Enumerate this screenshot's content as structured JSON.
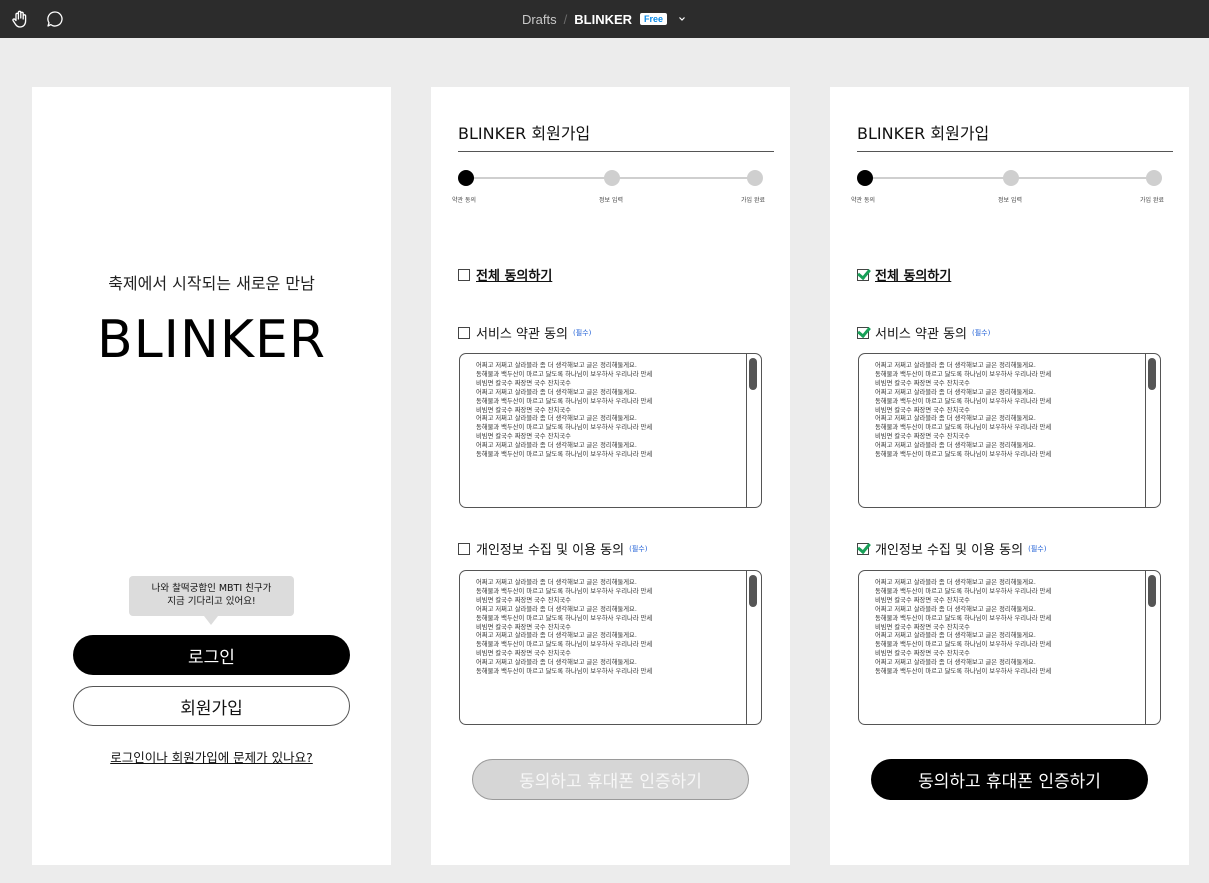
{
  "toolbar": {
    "breadcrumb_parent": "Drafts",
    "breadcrumb_separator": "/",
    "file_name": "BLINKER",
    "plan_badge": "Free",
    "icons": [
      "hand-tool-icon",
      "comment-icon",
      "chevron-down-icon"
    ]
  },
  "login": {
    "tagline": "축제에서 시작되는 새로운 만남",
    "logo": "BLINKER",
    "tooltip_line1": "나와 찰떡궁합인 MBTI 친구가",
    "tooltip_line2": "지금 기다리고 있어요!",
    "login_button": "로그인",
    "signup_button": "회원가입",
    "help_link": "로그인이나 회원가입에 문제가 있나요?"
  },
  "signup_unchecked": {
    "title": "BLINKER 회원가입",
    "steps": [
      "약관 동의",
      "정보 입력",
      "가입 완료"
    ],
    "current_step": 1,
    "agree_all": {
      "label": "전체 동의하기",
      "checked": false
    },
    "service_terms": {
      "label": "서비스 약관 동의",
      "required": "(필수)",
      "checked": false
    },
    "privacy_terms": {
      "label": "개인정보 수집 및 이용 동의",
      "required": "(필수)",
      "checked": false
    },
    "terms_text": "어쩌고 저쩌고 살라블라 좀 더 생각해보고 글은 정리해둘게요.\n동해물과 백두산이 마르고 닳도록 하나님이 보우하사 우리나라 만세\n비빔면 칼국수 짜장면 국수 잔치국수\n어쩌고 저쩌고 살라블라 좀 더 생각해보고 글은 정리해둘게요.\n동해물과 백두산이 마르고 닳도록 하나님이 보우하사 우리나라 만세\n비빔면 칼국수 짜장면 국수 잔치국수\n어쩌고 저쩌고 살라블라 좀 더 생각해보고 글은 정리해둘게요.\n동해물과 백두산이 마르고 닳도록 하나님이 보우하사 우리나라 만세\n비빔면 칼국수 짜장면 국수 잔치국수\n어쩌고 저쩌고 살라블라 좀 더 생각해보고 글은 정리해둘게요.\n동해물과 백두산이 마르고 닳도록 하나님이 보우하사 우리나라 만세",
    "cta": "동의하고 휴대폰 인증하기",
    "cta_state": "disabled"
  },
  "signup_checked": {
    "title": "BLINKER 회원가입",
    "steps": [
      "약관 동의",
      "정보 입력",
      "가입 완료"
    ],
    "current_step": 1,
    "agree_all": {
      "label": "전체 동의하기",
      "checked": true
    },
    "service_terms": {
      "label": "서비스 약관 동의",
      "required": "(필수)",
      "checked": true
    },
    "privacy_terms": {
      "label": "개인정보 수집 및 이용 동의",
      "required": "(필수)",
      "checked": true
    },
    "terms_text": "어쩌고 저쩌고 살라블라 좀 더 생각해보고 글은 정리해둘게요.\n동해물과 백두산이 마르고 닳도록 하나님이 보우하사 우리나라 만세\n비빔면 칼국수 짜장면 국수 잔치국수\n어쩌고 저쩌고 살라블라 좀 더 생각해보고 글은 정리해둘게요.\n동해물과 백두산이 마르고 닳도록 하나님이 보우하사 우리나라 만세\n비빔면 칼국수 짜장면 국수 잔치국수\n어쩌고 저쩌고 살라블라 좀 더 생각해보고 글은 정리해둘게요.\n동해물과 백두산이 마르고 닳도록 하나님이 보우하사 우리나라 만세\n비빔면 칼국수 짜장면 국수 잔치국수\n어쩌고 저쩌고 살라블라 좀 더 생각해보고 글은 정리해둘게요.\n동해물과 백두산이 마르고 닳도록 하나님이 보우하사 우리나라 만세",
    "cta": "동의하고 휴대폰 인증하기",
    "cta_state": "enabled"
  },
  "colors": {
    "toolbar_bg": "#2c2c2c",
    "canvas_bg": "#ececec",
    "primary": "#000000",
    "disabled_button": "#d6d6d6",
    "check_green": "#18a058",
    "required_blue": "#1f5fd6",
    "badge_blue": "#0d8ce9"
  }
}
